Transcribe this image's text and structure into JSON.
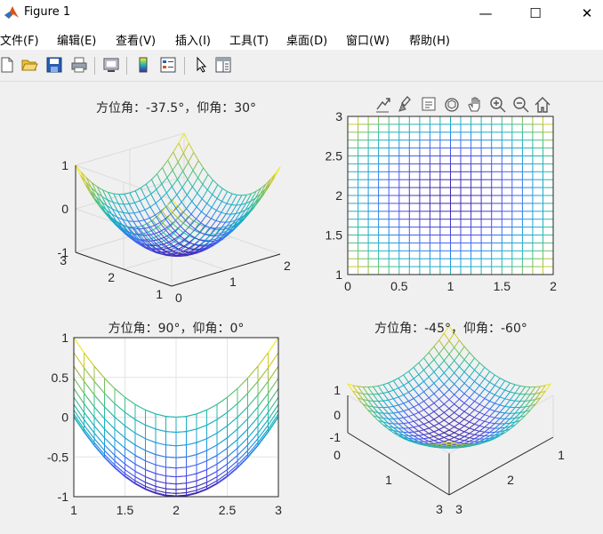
{
  "window": {
    "title": "Figure 1",
    "minimize": "—",
    "maximize": "☐",
    "close": "✕"
  },
  "menu": [
    "文件(F)",
    "编辑(E)",
    "查看(V)",
    "插入(I)",
    "工具(T)",
    "桌面(D)",
    "窗口(W)",
    "帮助(H)"
  ],
  "toolbar": [
    "new-figure",
    "open-file",
    "save",
    "print",
    "print-preview",
    "colorbar",
    "legend",
    "edit-plot",
    "property-inspector"
  ],
  "axes_toolbar": [
    "export",
    "brush",
    "data-tips",
    "rotate-3d",
    "pan",
    "zoom-in",
    "zoom-out",
    "home"
  ],
  "colors": {
    "colormap": [
      "#3e26a8",
      "#4a57f2",
      "#1c9bde",
      "#1fb8b2",
      "#62c26a",
      "#c9c12c",
      "#f9fb15"
    ]
  },
  "chart_data": [
    {
      "type": "surface",
      "surface": "z = (x-2)^2 + (y-2)^2 - 1",
      "style": "mesh",
      "title": "方位角：-37.5°，仰角：30°",
      "view": {
        "azimuth": -37.5,
        "elevation": 30
      },
      "xlim": [
        0,
        2
      ],
      "ylim": [
        1,
        3
      ],
      "zlim": [
        -1,
        1
      ],
      "xticks": [
        "0",
        "1",
        "2"
      ],
      "yticks": [
        "1",
        "2",
        "3"
      ],
      "zticks": [
        "-1",
        "0",
        "1"
      ],
      "grid": true
    },
    {
      "type": "surface",
      "surface": "z = (x-2)^2 + (y-2)^2 - 1",
      "style": "mesh",
      "title": "",
      "view": {
        "azimuth": 0,
        "elevation": 90
      },
      "xlim": [
        0,
        2
      ],
      "ylim": [
        1,
        3
      ],
      "xticks": [
        "0",
        "0.5",
        "1",
        "1.5",
        "2"
      ],
      "yticks": [
        "1",
        "1.5",
        "2",
        "2.5",
        "3"
      ],
      "grid": false
    },
    {
      "type": "surface",
      "surface": "z = (x-2)^2 + (y-2)^2 - 1",
      "style": "mesh",
      "title": "方位角：90°，仰角：0°",
      "view": {
        "azimuth": 90,
        "elevation": 0
      },
      "ylim": [
        1,
        3
      ],
      "zlim": [
        -1,
        1
      ],
      "xticks": [
        "1",
        "1.5",
        "2",
        "2.5",
        "3"
      ],
      "yticks": [
        "-1",
        "-0.5",
        "0",
        "0.5",
        "1"
      ],
      "grid": true
    },
    {
      "type": "surface",
      "surface": "z = (x-2)^2 + (y-2)^2 - 1",
      "style": "mesh",
      "title": "方位角：-45°，仰角：-60°",
      "view": {
        "azimuth": -45,
        "elevation": -60
      },
      "xlim": [
        0,
        1
      ],
      "ylim": [
        1,
        3
      ],
      "zlim": [
        -1,
        1
      ],
      "xticks": [
        "0",
        "1"
      ],
      "yticks": [
        "1",
        "2",
        "3"
      ],
      "zticks": [
        "-1",
        "0",
        "1"
      ],
      "grid": true
    }
  ]
}
